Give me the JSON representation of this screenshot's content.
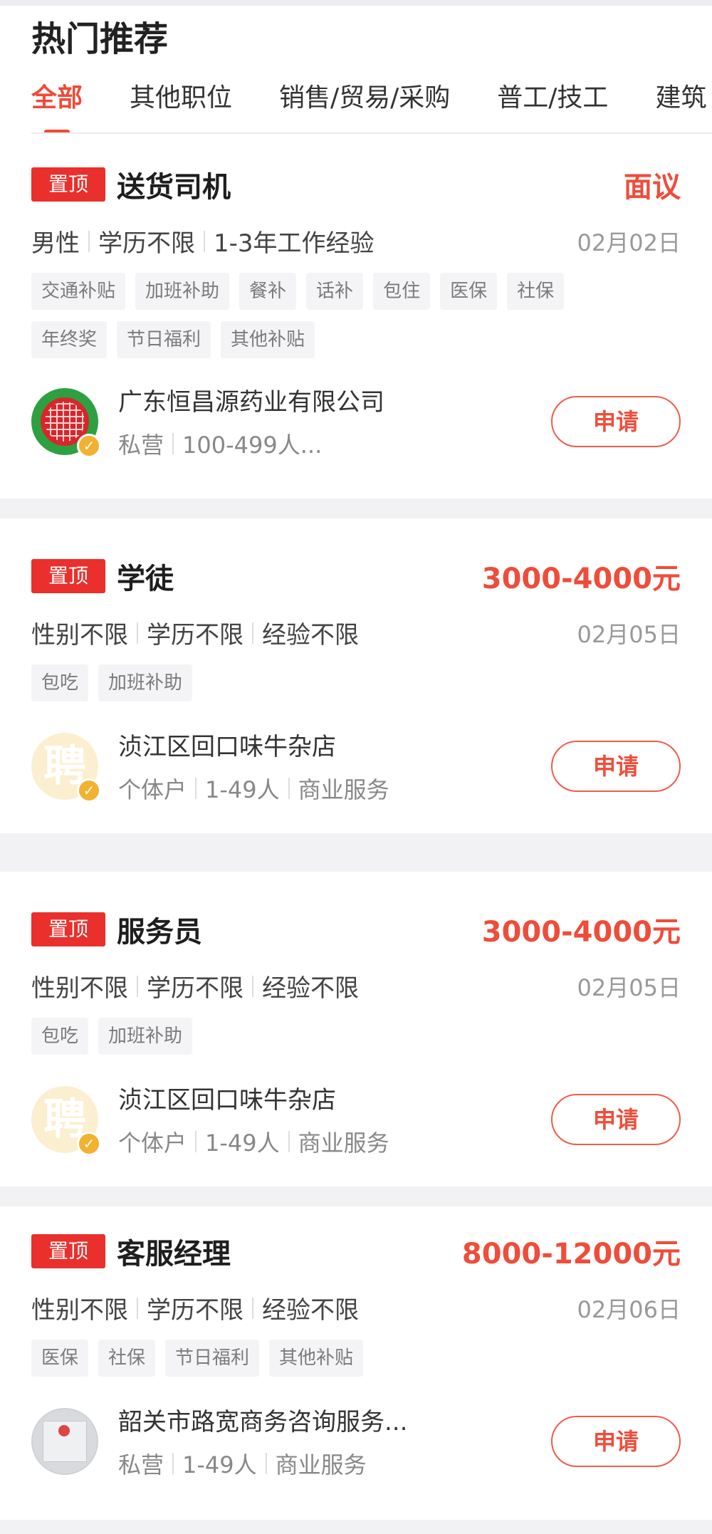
{
  "section_title": "热门推荐",
  "tabs": [
    {
      "label": "全部",
      "active": true
    },
    {
      "label": "其他职位"
    },
    {
      "label": "销售/贸易/采购"
    },
    {
      "label": "普工/技工"
    },
    {
      "label": "建筑"
    }
  ],
  "pin_label": "置顶",
  "apply_label": "申请",
  "jobs": [
    {
      "title": "送货司机",
      "salary": "面议",
      "requirements": [
        "男性",
        "学历不限",
        "1-3年工作经验"
      ],
      "date": "02月02日",
      "benefits": [
        "交通补贴",
        "加班补助",
        "餐补",
        "话补",
        "包住",
        "医保",
        "社保",
        "年终奖",
        "节日福利",
        "其他补贴"
      ],
      "company": {
        "name": "广东恒昌源药业有限公司",
        "meta": [
          "私营",
          "100-499人..."
        ],
        "logo": "red-globe-logo"
      }
    },
    {
      "title": "学徒",
      "salary": "3000-4000元",
      "requirements": [
        "性别不限",
        "学历不限",
        "经验不限"
      ],
      "date": "02月05日",
      "benefits": [
        "包吃",
        "加班补助"
      ],
      "company": {
        "name": "浈江区回口味牛杂店",
        "meta": [
          "个体户",
          "1-49人",
          "商业服务"
        ],
        "logo": "聘"
      }
    },
    {
      "title": "服务员",
      "salary": "3000-4000元",
      "requirements": [
        "性别不限",
        "学历不限",
        "经验不限"
      ],
      "date": "02月05日",
      "benefits": [
        "包吃",
        "加班补助"
      ],
      "company": {
        "name": "浈江区回口味牛杂店",
        "meta": [
          "个体户",
          "1-49人",
          "商业服务"
        ],
        "logo": "聘"
      }
    },
    {
      "title": "客服经理",
      "salary": "8000-12000元",
      "requirements": [
        "性别不限",
        "学历不限",
        "经验不限"
      ],
      "date": "02月06日",
      "benefits": [
        "医保",
        "社保",
        "节日福利",
        "其他补贴"
      ],
      "company": {
        "name": "韶关市路宽商务咨询服务...",
        "meta": [
          "私营",
          "1-49人",
          "商业服务"
        ],
        "logo": "license-photo"
      }
    }
  ]
}
